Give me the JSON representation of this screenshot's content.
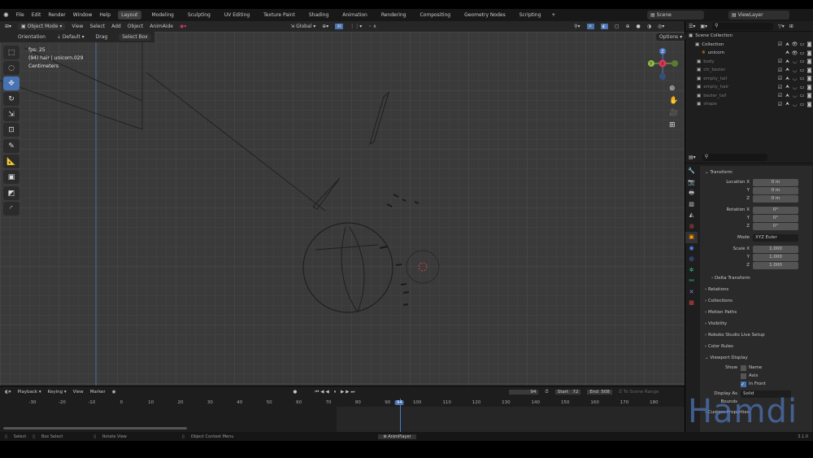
{
  "menu": [
    "File",
    "Edit",
    "Render",
    "Window",
    "Help"
  ],
  "workspaces": [
    "Layout",
    "Modeling",
    "Sculpting",
    "UV Editing",
    "Texture Paint",
    "Shading",
    "Animation",
    "Rendering",
    "Compositing",
    "Geometry Nodes",
    "Scripting",
    "+"
  ],
  "scene": "Scene",
  "view_layer": "ViewLayer",
  "header": {
    "mode": "Object Mode",
    "items": [
      "View",
      "Select",
      "Add",
      "Object",
      "AnimAide"
    ],
    "orientation_global": "Global",
    "options": "Options"
  },
  "tool_settings": {
    "orientation_label": "Orientation",
    "orientation": "Default",
    "drag_label": "Drag",
    "drag": "Select Box"
  },
  "overlay": {
    "fps": "fps: 25",
    "object": "(94) hair | unicorn.029",
    "units": "Centimeters"
  },
  "gizmo": {
    "z": "Z",
    "y": "Y",
    "x": "X"
  },
  "outliner": {
    "root": "Scene Collection",
    "items": [
      {
        "name": "Collection",
        "dim": false
      },
      {
        "name": "unicorn",
        "dim": false
      },
      {
        "name": "body",
        "dim": true
      },
      {
        "name": "ctr_bezier",
        "dim": true
      },
      {
        "name": "empty_tail",
        "dim": true
      },
      {
        "name": "empty_hair",
        "dim": true
      },
      {
        "name": "bezier_tail",
        "dim": true
      },
      {
        "name": "shape",
        "dim": true
      }
    ]
  },
  "properties": {
    "transform": "Transform",
    "location": {
      "label": "Location X",
      "x": "0 m",
      "y": "0 m",
      "z": "0 m"
    },
    "rotation": {
      "label": "Rotation X",
      "x": "0°",
      "y": "0°",
      "z": "0°"
    },
    "mode_label": "Mode",
    "mode": "XYZ Euler",
    "scale": {
      "label": "Scale X",
      "x": "1.000",
      "y": "1.000",
      "z": "1.000"
    },
    "axis_y": "Y",
    "axis_z": "Z",
    "delta": "Delta Transform",
    "sections": [
      "Relations",
      "Collections",
      "Motion Paths",
      "Visibility",
      "Rokoko Studio Live Setup",
      "Color Rules"
    ],
    "viewport_display": "Viewport Display",
    "show_label": "Show",
    "name": "Name",
    "axis": "Axis",
    "in_front": "In Front",
    "display_as_label": "Display As",
    "display_as": "Solid",
    "bounds": "Bounds",
    "custom": "Custom Properties"
  },
  "timeline": {
    "menus": [
      "Playback",
      "Keying",
      "View",
      "Marker"
    ],
    "current": "94",
    "start_label": "Start",
    "start": "72",
    "end_label": "End",
    "end": "508",
    "to_scene": "To Scene Range",
    "ticks": [
      "-30",
      "-20",
      "-10",
      "0",
      "10",
      "20",
      "30",
      "40",
      "50",
      "60",
      "70",
      "80",
      "90",
      "94",
      "100",
      "110",
      "120",
      "130",
      "140",
      "150",
      "160",
      "170",
      "180"
    ]
  },
  "status": {
    "select": "Select",
    "box_select": "Box Select",
    "rotate": "Rotate View",
    "context": "Object Context Menu",
    "addon": "AnimPlayer",
    "version": "3.1.0"
  },
  "watermark": "Hamdi"
}
